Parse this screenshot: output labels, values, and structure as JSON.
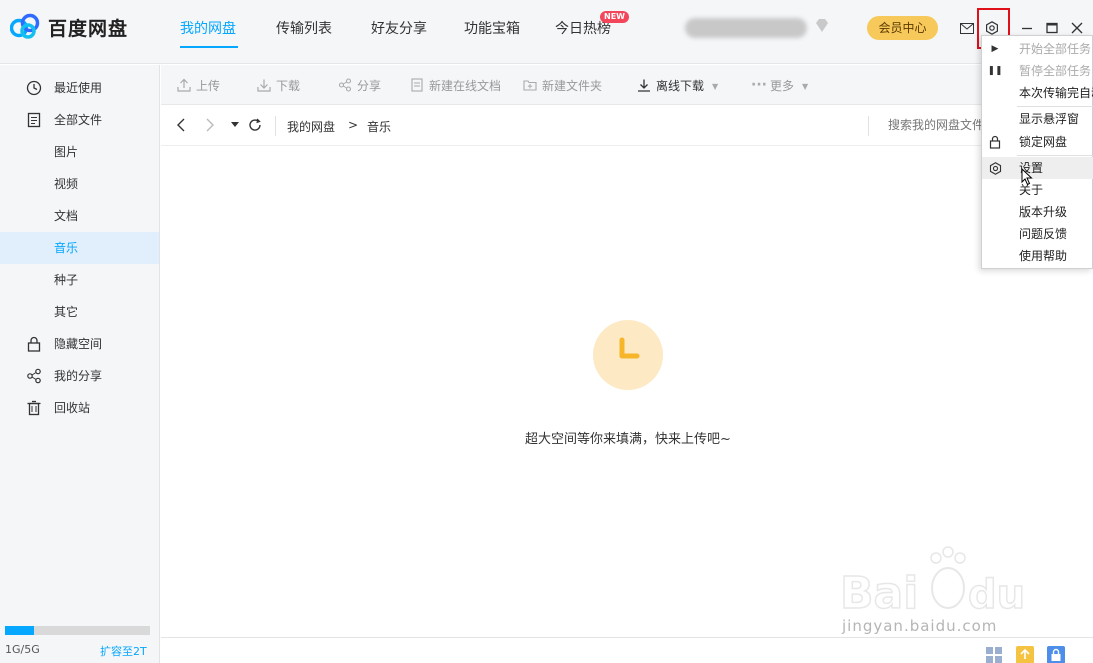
{
  "app": {
    "title": "百度网盘",
    "brand_color": "#06a7ff"
  },
  "nav": {
    "tabs": [
      {
        "label": "我的网盘",
        "active": true
      },
      {
        "label": "传输列表"
      },
      {
        "label": "好友分享"
      },
      {
        "label": "功能宝箱"
      },
      {
        "label": "今日热榜"
      }
    ],
    "new_badge": "NEW",
    "vip_button": "会员中心"
  },
  "sidebar": {
    "items": [
      {
        "label": "最近使用",
        "icon": "clock-icon"
      },
      {
        "label": "全部文件",
        "icon": "file-icon"
      },
      {
        "label": "图片"
      },
      {
        "label": "视频"
      },
      {
        "label": "文档"
      },
      {
        "label": "音乐",
        "active": true
      },
      {
        "label": "种子"
      },
      {
        "label": "其它"
      },
      {
        "label": "隐藏空间",
        "icon": "lock-icon"
      },
      {
        "label": "我的分享",
        "icon": "share-icon"
      },
      {
        "label": "回收站",
        "icon": "trash-icon"
      }
    ],
    "quota": {
      "text": "1G/5G",
      "used_fraction": 0.2,
      "upgrade": "扩容至2T"
    }
  },
  "toolbar": {
    "upload": "上传",
    "download": "下载",
    "share": "分享",
    "new_online_doc": "新建在线文档",
    "new_folder": "新建文件夹",
    "offline_download": "离线下载",
    "more": "更多"
  },
  "addressbar": {
    "breadcrumb": [
      "我的网盘",
      "音乐"
    ],
    "separator": ">",
    "search_placeholder": "搜索我的网盘文件"
  },
  "empty_state": {
    "message": "超大空间等你来填满，快来上传吧~"
  },
  "menu": {
    "items": [
      {
        "label": "开始全部任务",
        "disabled": true,
        "icon": "play-icon"
      },
      {
        "label": "暂停全部任务",
        "disabled": true,
        "icon": "pause-icon"
      },
      {
        "label": "本次传输完自动关机"
      },
      {
        "label": "显示悬浮窗"
      },
      {
        "label": "锁定网盘",
        "icon": "lock-icon"
      },
      {
        "label": "设置",
        "icon": "gear-icon",
        "hover": true
      },
      {
        "label": "关于"
      },
      {
        "label": "版本升级"
      },
      {
        "label": "问题反馈"
      },
      {
        "label": "使用帮助"
      }
    ]
  },
  "watermark": {
    "text": "jingyan.baidu.com"
  }
}
